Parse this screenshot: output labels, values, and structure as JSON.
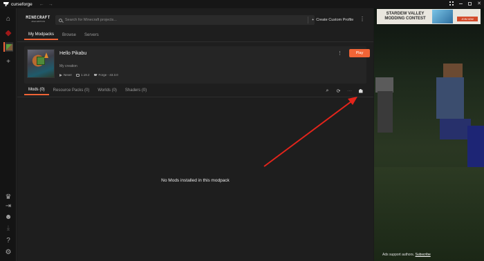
{
  "app": {
    "name": "curseforge"
  },
  "header": {
    "game_logo_line1": "MINECRAFT",
    "game_logo_line2": "JAVA EDITION",
    "search_placeholder": "Search for Minecraft projects...",
    "custom_profile_label": "Create Custom Profile"
  },
  "tabs": [
    {
      "label": "My Modpacks",
      "active": true
    },
    {
      "label": "Browse",
      "active": false
    },
    {
      "label": "Servers",
      "active": false
    }
  ],
  "modpack": {
    "title": "Hello Pikabu",
    "description": "My creation",
    "last_played": "Never",
    "version": "1.19.2",
    "loader": "Forge - 43.3.0",
    "play_label": "Play"
  },
  "subtabs": [
    {
      "label": "Mods (0)",
      "active": true
    },
    {
      "label": "Resource Packs (0)",
      "active": false
    },
    {
      "label": "Worlds (0)",
      "active": false
    },
    {
      "label": "Shaders (0)",
      "active": false
    }
  ],
  "empty_message": "No Mods installed in this modpack",
  "ad": {
    "banner_title": "STARDEW VALLEY MODDING CONTEST",
    "banner_button": "JOIN NOW",
    "footer_text": "Ads support authors.",
    "footer_link": "Subscribe"
  },
  "colors": {
    "accent": "#f16436",
    "annotation_arrow": "#e3241b"
  },
  "icons": {
    "sidebar": [
      "home-icon",
      "spider-icon",
      "minecraft-icon",
      "plus-icon",
      "crown-icon",
      "login-icon",
      "discord-icon",
      "download-icon",
      "help-icon",
      "settings-icon"
    ],
    "toolbar": [
      "search-icon",
      "refresh-icon",
      "more-icon",
      "puzzle-icon"
    ]
  }
}
